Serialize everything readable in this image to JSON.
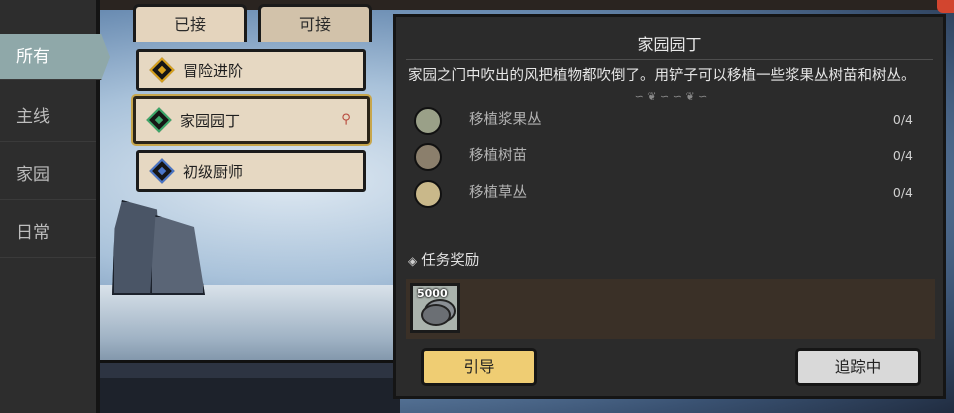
{
  "nav": {
    "items": [
      {
        "label": "所有",
        "active": true
      },
      {
        "label": "主线",
        "active": false
      },
      {
        "label": "家园",
        "active": false
      },
      {
        "label": "日常",
        "active": false
      }
    ]
  },
  "tabs": [
    {
      "label": "已接",
      "active": true
    },
    {
      "label": "可接",
      "active": false
    }
  ],
  "quests": [
    {
      "label": "冒险进阶",
      "icon": "quest-gem-icon",
      "selected": false
    },
    {
      "label": "家园园丁",
      "icon": "quest-gem-icon",
      "selected": true
    },
    {
      "label": "初级厨师",
      "icon": "quest-gem-icon",
      "selected": false
    }
  ],
  "detail": {
    "title": "家园园丁",
    "description": "家园之门中吹出的风把植物都吹倒了。用铲子可以移植一些浆果丛树苗和树丛。",
    "ornament": "∽ ❦ ∽   ∽ ❦ ∽",
    "objectives": [
      {
        "name": "移植浆果丛",
        "progress": "0/4",
        "icon": "berry-bush-icon",
        "color": "#9aa088"
      },
      {
        "name": "移植树苗",
        "progress": "0/4",
        "icon": "sapling-icon",
        "color": "#8b7f6c"
      },
      {
        "name": "移植草丛",
        "progress": "0/4",
        "icon": "grass-tuft-icon",
        "color": "#c9b88a"
      }
    ],
    "reward_header": "任务奖励",
    "rewards": [
      {
        "quantity": "5000",
        "icon": "silver-coins-icon"
      }
    ],
    "guide_button": "引导",
    "track_button": "追踪中"
  },
  "colors": {
    "accent_gold": "#efcd73",
    "nav_active": "#8fa8a9",
    "card_bg": "#e6d8c2",
    "panel_bg": "#2b2b2b"
  }
}
